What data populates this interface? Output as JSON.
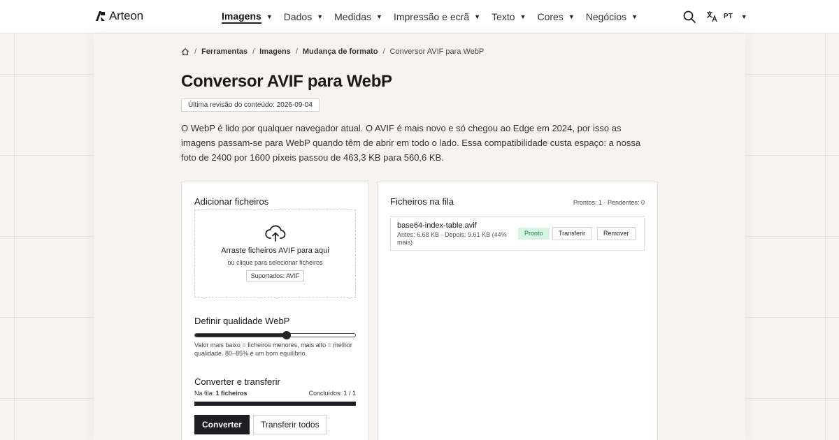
{
  "brand": {
    "name": "Arteon"
  },
  "nav": {
    "items": [
      {
        "label": "Imagens",
        "active": true
      },
      {
        "label": "Dados"
      },
      {
        "label": "Medidas"
      },
      {
        "label": "Impressão e ecrã"
      },
      {
        "label": "Texto"
      },
      {
        "label": "Cores"
      },
      {
        "label": "Negócios"
      }
    ],
    "language": "PT"
  },
  "breadcrumb": {
    "items": [
      "Ferramentas",
      "Imagens",
      "Mudança de formato"
    ],
    "current": "Conversor AVIF para WebP"
  },
  "page": {
    "title": "Conversor AVIF para WebP",
    "revision": "Última revisão do conteúdo: 2026-09-04",
    "intro": "O WebP é lido por qualquer navegador atual. O AVIF é mais novo e só chegou ao Edge em 2024, por isso as imagens passam-se para WebP quando têm de abrir em todo o lado. Essa compatibilidade custa espaço: a nossa foto de 2400 por 1600 píxeis passou de 463,3 KB para 560,6 KB."
  },
  "upload": {
    "heading": "Adicionar ficheiros",
    "drop_title": "Arraste ficheiros AVIF para aqui",
    "drop_sub": "ou clique para selecionar ficheiros",
    "supported": "Suportados: AVIF"
  },
  "quality": {
    "heading": "Definir qualidade WebP",
    "value_fraction": 0.57,
    "help": "Valor mais baixo = ficheiros menores, mais alto = melhor qualidade. 80–85% é um bom equilíbrio."
  },
  "convert": {
    "heading": "Converter e transferir",
    "queue_label": "Na fila: ",
    "queue_count": "1 ficheiros",
    "done_label": "Concluídos: 1 / 1",
    "progress_fraction": 1.0,
    "convert_button": "Converter",
    "download_all_button": "Transferir todos"
  },
  "queue": {
    "heading": "Ficheiros na fila",
    "meta": "Prontos: 1 · Pendentes: 0",
    "files": [
      {
        "name": "base64-index-table.avif",
        "sizes": "Antes: 6.68 KB · Depois: 9.61 KB (44% mais)",
        "status": "Pronto",
        "download": "Transferir",
        "remove": "Remover"
      }
    ]
  },
  "colors": {
    "accent_dark": "#1e1d24",
    "status_ready_bg": "#d7f5e3",
    "status_ready_text": "#1e7a45",
    "page_bg": "#f7f3ef"
  }
}
